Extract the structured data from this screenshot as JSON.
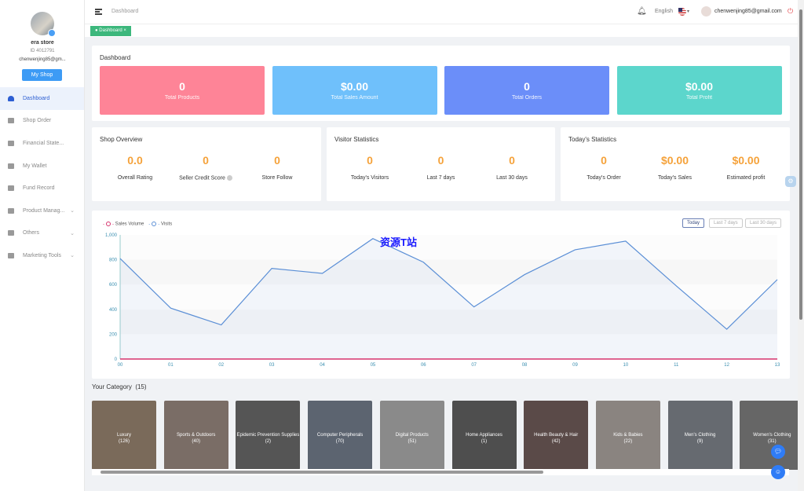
{
  "sidebar": {
    "store_name": "era store",
    "store_id": "ID 4012791",
    "email": "chenwenjing85@gm...",
    "my_shop": "My Shop",
    "items": [
      {
        "label": "Dashboard",
        "active": true
      },
      {
        "label": "Shop Order"
      },
      {
        "label": "Financial State..."
      },
      {
        "label": "My Wallet"
      },
      {
        "label": "Fund Record"
      },
      {
        "label": "Product Manag...",
        "expandable": true
      },
      {
        "label": "Others",
        "expandable": true
      },
      {
        "label": "Marketing Tools",
        "expandable": true
      }
    ]
  },
  "topbar": {
    "breadcrumb": "Dashboard",
    "language": "English",
    "user_email": "chenwenjing85@gmail.com"
  },
  "tabs": [
    {
      "label": "Dashboard",
      "close": "×"
    }
  ],
  "dashboard": {
    "title": "Dashboard",
    "stats": [
      {
        "value": "0",
        "label": "Total Products",
        "color": "#fe8497"
      },
      {
        "value": "$0.00",
        "label": "Total Sales Amount",
        "color": "#6fc0fb"
      },
      {
        "value": "0",
        "label": "Total Orders",
        "color": "#6b8ef9"
      },
      {
        "value": "$0.00",
        "label": "Total Profit",
        "color": "#5cd6cc"
      }
    ]
  },
  "shop_overview": {
    "title": "Shop Overview",
    "items": [
      {
        "value": "0.0",
        "label": "Overall Rating"
      },
      {
        "value": "0",
        "label": "Seller Credit Score"
      },
      {
        "value": "0",
        "label": "Store Follow"
      }
    ]
  },
  "visitor_statistics": {
    "title": "Visitor Statistics",
    "items": [
      {
        "value": "0",
        "label": "Today's Visitors"
      },
      {
        "value": "0",
        "label": "Last 7 days"
      },
      {
        "value": "0",
        "label": "Last 30 days"
      }
    ]
  },
  "todays_statistics": {
    "title": "Today's Statistics",
    "items": [
      {
        "value": "0",
        "label": "Today's Order"
      },
      {
        "value": "$0.00",
        "label": "Today's Sales"
      },
      {
        "value": "$0.00",
        "label": "Estimated profit"
      }
    ]
  },
  "range_buttons": [
    "Today",
    "Last 7 days",
    "Last 30 days"
  ],
  "watermark": "资源T站",
  "chart_data": {
    "type": "line",
    "x": [
      "00",
      "01",
      "02",
      "03",
      "04",
      "05",
      "06",
      "07",
      "08",
      "09",
      "10",
      "11",
      "12",
      "13"
    ],
    "series": [
      {
        "name": "Sales Volume",
        "color": "#d6336c",
        "values": [
          0,
          0,
          0,
          0,
          0,
          0,
          0,
          0,
          0,
          0,
          0,
          0,
          0,
          0
        ]
      },
      {
        "name": "Visits",
        "color": "#5b8fd6",
        "values": [
          810,
          410,
          275,
          730,
          690,
          970,
          780,
          420,
          680,
          880,
          950,
          590,
          240,
          640
        ]
      }
    ],
    "yticks": [
      "0",
      "200",
      "400",
      "600",
      "800",
      "1,000"
    ],
    "ylim": [
      0,
      1000
    ],
    "legend": "top-left"
  },
  "category": {
    "title": "Your Category",
    "count": "(15)",
    "items": [
      {
        "name": "Luxury",
        "count": "(126)"
      },
      {
        "name": "Sports & Outdoors",
        "count": "(40)"
      },
      {
        "name": "Epidemic Prevention Supplies",
        "count": "(2)"
      },
      {
        "name": "Computer Peripherals",
        "count": "(70)"
      },
      {
        "name": "Digital Products",
        "count": "(51)"
      },
      {
        "name": "Home Appliances",
        "count": "(1)"
      },
      {
        "name": "Health Beauty & Hair",
        "count": "(42)"
      },
      {
        "name": "Kids & Babies",
        "count": "(22)"
      },
      {
        "name": "Men's Clothing",
        "count": "(9)"
      },
      {
        "name": "Women's Clothing",
        "count": "(31)"
      }
    ]
  }
}
